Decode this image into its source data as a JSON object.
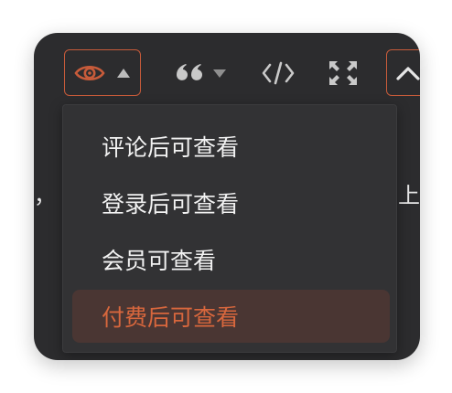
{
  "toolbar": {
    "items": [
      {
        "icon": "eye-icon",
        "has_dropdown": true,
        "active": true
      },
      {
        "icon": "quote-icon",
        "has_dropdown": true,
        "active": false
      },
      {
        "icon": "code-icon",
        "has_dropdown": false,
        "active": false
      },
      {
        "icon": "fullscreen-icon",
        "has_dropdown": false,
        "active": false
      },
      {
        "icon": "chevron-up-icon",
        "has_dropdown": false,
        "active": true
      }
    ]
  },
  "background": {
    "left_fragment": "，",
    "right_fragment": "上"
  },
  "menu": {
    "items": [
      {
        "label": "评论后可查看",
        "selected": false
      },
      {
        "label": "登录后可查看",
        "selected": false
      },
      {
        "label": "会员可查看",
        "selected": false
      },
      {
        "label": "付费后可查看",
        "selected": true
      }
    ]
  },
  "colors": {
    "accent": "#d8673d",
    "panel": "#2c2c2e",
    "menu": "#323234",
    "selected_bg": "#4a3633",
    "icon": "#c9c9c9"
  }
}
